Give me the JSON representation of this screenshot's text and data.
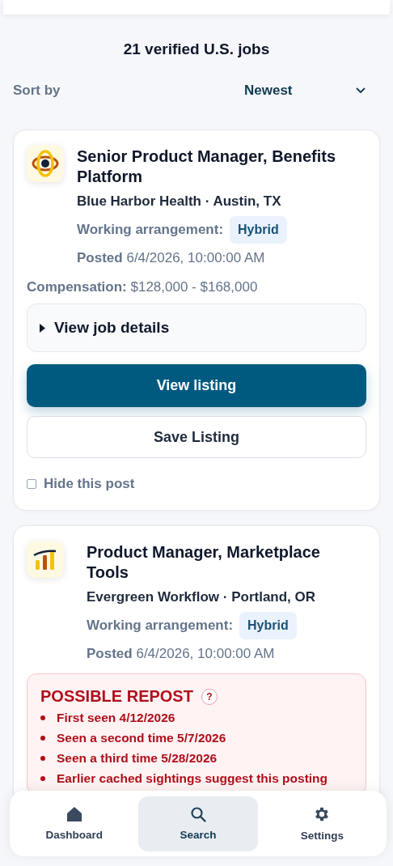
{
  "header": {
    "title": "21 verified U.S. jobs"
  },
  "sort": {
    "label": "Sort by",
    "value": "Newest"
  },
  "jobs": [
    {
      "title": "Senior Product Manager, Benefits Platform",
      "company": "Blue Harbor Health · Austin, TX",
      "arrangement_label": "Working arrangement:",
      "arrangement": "Hybrid",
      "posted_label": "Posted",
      "posted": "6/4/2026, 10:00:00 AM",
      "compensation_label": "Compensation:",
      "compensation": "$128,000 - $168,000",
      "details": {
        "label": "View job details",
        "expanded": false
      },
      "primary_button": "View listing",
      "secondary_button": "Save Listing",
      "hide": {
        "label": "Hide this post",
        "checked": false
      }
    },
    {
      "title": "Product Manager, Marketplace Tools",
      "company": "Evergreen Workflow · Portland, OR",
      "arrangement_label": "Working arrangement:",
      "arrangement": "Hybrid",
      "posted_label": "Posted",
      "posted": "6/4/2026, 10:00:00 AM",
      "repost": {
        "title": "POSSIBLE REPOST",
        "help": "?",
        "items": [
          "First seen 4/12/2026",
          "Seen a second time 5/7/2026",
          "Seen a third time 5/28/2026",
          "Earlier cached sightings suggest this posting"
        ]
      }
    }
  ],
  "nav": [
    {
      "label": "Dashboard",
      "selected": false
    },
    {
      "label": "Search",
      "selected": true
    },
    {
      "label": "Settings",
      "selected": false
    }
  ]
}
